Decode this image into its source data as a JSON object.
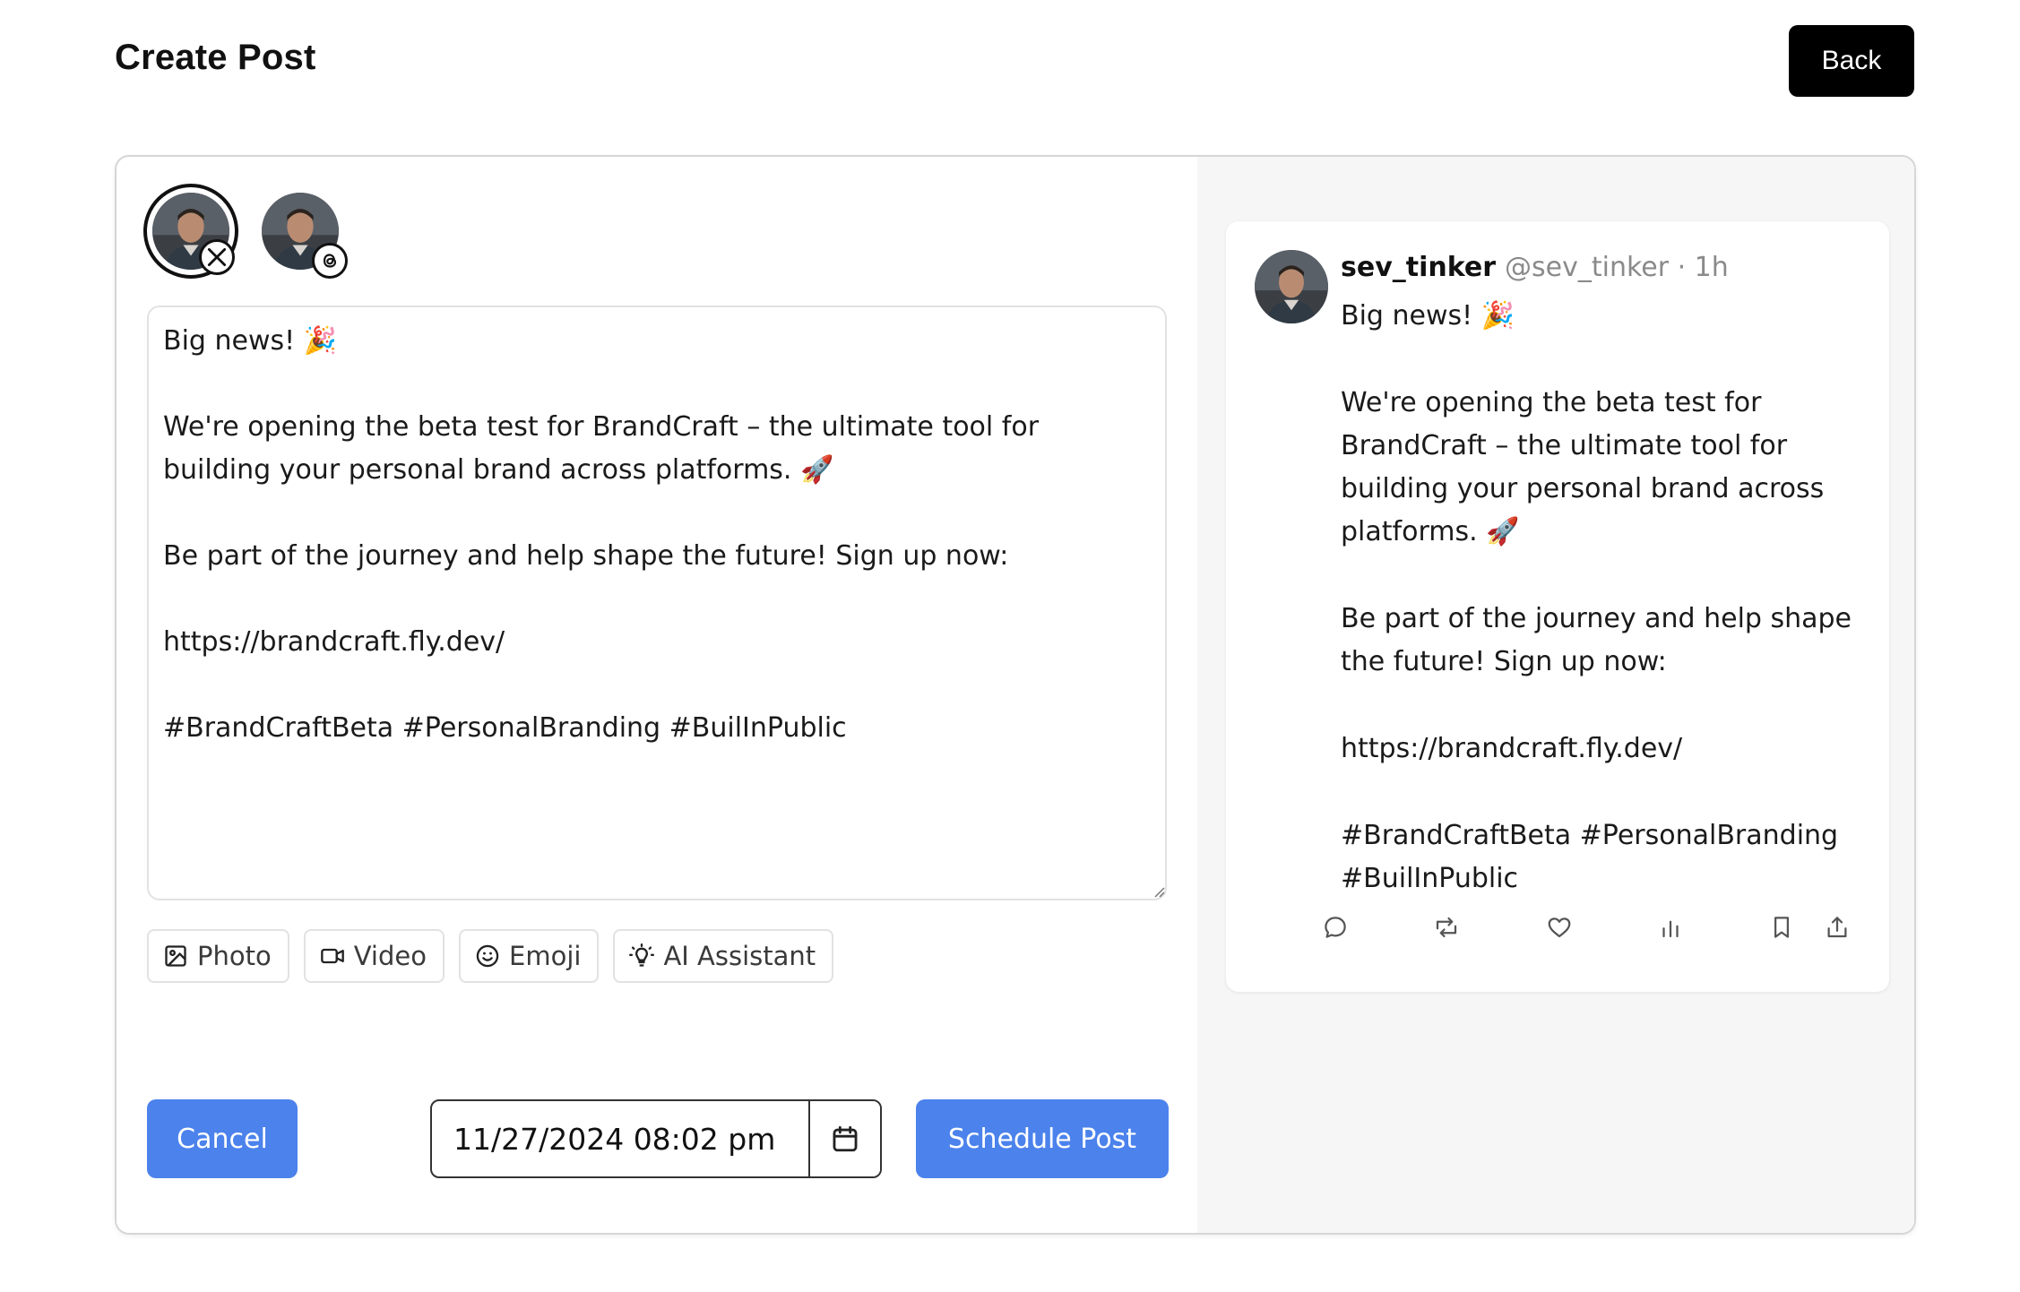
{
  "header": {
    "title": "Create Post",
    "back_label": "Back"
  },
  "accounts": [
    {
      "platform": "x",
      "selected": true,
      "badge_icon": "x-logo-icon"
    },
    {
      "platform": "threads",
      "selected": false,
      "badge_icon": "threads-logo-icon"
    }
  ],
  "editor": {
    "content": "Big news! 🎉\n\nWe're opening the beta test for BrandCraft – the ultimate tool for\nbuilding your personal brand across platforms. 🚀\n\nBe part of the journey and help shape the future! Sign up now:\n\nhttps://brandcraft.fly.dev/\n\n#BrandCraftBeta #PersonalBranding #BuilInPublic"
  },
  "tools": {
    "photo": "Photo",
    "video": "Video",
    "emoji": "Emoji",
    "ai": "AI Assistant"
  },
  "footer": {
    "cancel": "Cancel",
    "datetime": "11/27/2024 08:02 pm",
    "schedule": "Schedule Post"
  },
  "preview": {
    "name": "sev_tinker",
    "handle": "@sev_tinker · 1h",
    "text": "Big news! 🎉\n\nWe're opening the beta test for\nBrandCraft – the ultimate tool for\nbuilding your personal brand across\nplatforms. 🚀\n\nBe part of the journey and help shape\nthe future! Sign up now:\n\nhttps://brandcraft.fly.dev/\n\n#BrandCraftBeta #PersonalBranding\n#BuilInPublic",
    "actions": [
      "reply-icon",
      "repost-icon",
      "like-icon",
      "views-icon",
      "bookmark-icon",
      "share-icon"
    ]
  },
  "colors": {
    "primary": "#4b82ec",
    "back_button": "#000000",
    "preview_bg": "#f6f6f7"
  }
}
